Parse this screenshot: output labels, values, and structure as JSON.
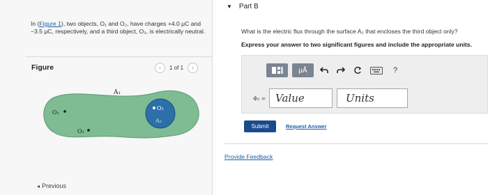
{
  "problem": {
    "prefix": "In (",
    "figure_link": "Figure 1",
    "body": "), two objects, O₁ and O₂, have charges +4.0 μC and −3.5 μC, respectively, and a third object, O₃, is electrically neutral."
  },
  "figure": {
    "label": "Figure",
    "pager_text": "1 of 1",
    "prev_arrow": "‹",
    "next_arrow": "›",
    "surface_label": "A₁",
    "surface2_label": "A₂",
    "obj1": "O₁",
    "obj2": "O₂",
    "obj3": "O₃",
    "surface_fill": "#7fbb93",
    "inner_fill": "#2d6fa8"
  },
  "nav": {
    "previous": "Previous",
    "previous_icon": "chevron-left-icon"
  },
  "part": {
    "title": "Part B",
    "caret": "▼"
  },
  "question": "What is the electric flux through the surface A₂ that encloses the third object only?",
  "instruction": "Express your answer to two significant figures and include the appropriate units.",
  "toolbar": {
    "template_icon": "template-icon",
    "units_label": "μÅ",
    "undo_icon": "undo-icon",
    "redo_icon": "redo-icon",
    "reset_icon": "reset-icon",
    "keyboard_icon": "keyboard-icon",
    "help_label": "?"
  },
  "answer": {
    "symbol_label": "Φ₂ =",
    "value_placeholder": "Value",
    "units_placeholder": "Units"
  },
  "submit_label": "Submit",
  "request_answer_label": "Request Answer",
  "provide_feedback_label": "Provide Feedback"
}
